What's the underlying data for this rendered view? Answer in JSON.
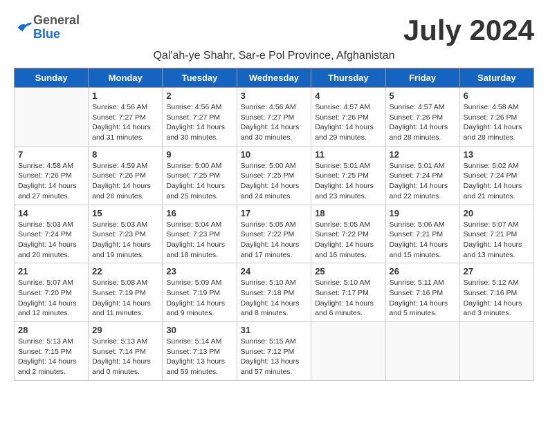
{
  "header": {
    "logo_general": "General",
    "logo_blue": "Blue",
    "month_year": "July 2024",
    "location": "Qal'ah-ye Shahr, Sar-e Pol Province, Afghanistan"
  },
  "days_of_week": [
    "Sunday",
    "Monday",
    "Tuesday",
    "Wednesday",
    "Thursday",
    "Friday",
    "Saturday"
  ],
  "weeks": [
    [
      {
        "day": "",
        "detail": ""
      },
      {
        "day": "1",
        "detail": "Sunrise: 4:56 AM\nSunset: 7:27 PM\nDaylight: 14 hours\nand 31 minutes."
      },
      {
        "day": "2",
        "detail": "Sunrise: 4:56 AM\nSunset: 7:27 PM\nDaylight: 14 hours\nand 30 minutes."
      },
      {
        "day": "3",
        "detail": "Sunrise: 4:56 AM\nSunset: 7:27 PM\nDaylight: 14 hours\nand 30 minutes."
      },
      {
        "day": "4",
        "detail": "Sunrise: 4:57 AM\nSunset: 7:26 PM\nDaylight: 14 hours\nand 29 minutes."
      },
      {
        "day": "5",
        "detail": "Sunrise: 4:57 AM\nSunset: 7:26 PM\nDaylight: 14 hours\nand 28 minutes."
      },
      {
        "day": "6",
        "detail": "Sunrise: 4:58 AM\nSunset: 7:26 PM\nDaylight: 14 hours\nand 28 minutes."
      }
    ],
    [
      {
        "day": "7",
        "detail": "Sunrise: 4:58 AM\nSunset: 7:26 PM\nDaylight: 14 hours\nand 27 minutes."
      },
      {
        "day": "8",
        "detail": "Sunrise: 4:59 AM\nSunset: 7:26 PM\nDaylight: 14 hours\nand 26 minutes."
      },
      {
        "day": "9",
        "detail": "Sunrise: 5:00 AM\nSunset: 7:25 PM\nDaylight: 14 hours\nand 25 minutes."
      },
      {
        "day": "10",
        "detail": "Sunrise: 5:00 AM\nSunset: 7:25 PM\nDaylight: 14 hours\nand 24 minutes."
      },
      {
        "day": "11",
        "detail": "Sunrise: 5:01 AM\nSunset: 7:25 PM\nDaylight: 14 hours\nand 23 minutes."
      },
      {
        "day": "12",
        "detail": "Sunrise: 5:01 AM\nSunset: 7:24 PM\nDaylight: 14 hours\nand 22 minutes."
      },
      {
        "day": "13",
        "detail": "Sunrise: 5:02 AM\nSunset: 7:24 PM\nDaylight: 14 hours\nand 21 minutes."
      }
    ],
    [
      {
        "day": "14",
        "detail": "Sunrise: 5:03 AM\nSunset: 7:24 PM\nDaylight: 14 hours\nand 20 minutes."
      },
      {
        "day": "15",
        "detail": "Sunrise: 5:03 AM\nSunset: 7:23 PM\nDaylight: 14 hours\nand 19 minutes."
      },
      {
        "day": "16",
        "detail": "Sunrise: 5:04 AM\nSunset: 7:23 PM\nDaylight: 14 hours\nand 18 minutes."
      },
      {
        "day": "17",
        "detail": "Sunrise: 5:05 AM\nSunset: 7:22 PM\nDaylight: 14 hours\nand 17 minutes."
      },
      {
        "day": "18",
        "detail": "Sunrise: 5:05 AM\nSunset: 7:22 PM\nDaylight: 14 hours\nand 16 minutes."
      },
      {
        "day": "19",
        "detail": "Sunrise: 5:06 AM\nSunset: 7:21 PM\nDaylight: 14 hours\nand 15 minutes."
      },
      {
        "day": "20",
        "detail": "Sunrise: 5:07 AM\nSunset: 7:21 PM\nDaylight: 14 hours\nand 13 minutes."
      }
    ],
    [
      {
        "day": "21",
        "detail": "Sunrise: 5:07 AM\nSunset: 7:20 PM\nDaylight: 14 hours\nand 12 minutes."
      },
      {
        "day": "22",
        "detail": "Sunrise: 5:08 AM\nSunset: 7:19 PM\nDaylight: 14 hours\nand 11 minutes."
      },
      {
        "day": "23",
        "detail": "Sunrise: 5:09 AM\nSunset: 7:19 PM\nDaylight: 14 hours\nand 9 minutes."
      },
      {
        "day": "24",
        "detail": "Sunrise: 5:10 AM\nSunset: 7:18 PM\nDaylight: 14 hours\nand 8 minutes."
      },
      {
        "day": "25",
        "detail": "Sunrise: 5:10 AM\nSunset: 7:17 PM\nDaylight: 14 hours\nand 6 minutes."
      },
      {
        "day": "26",
        "detail": "Sunrise: 5:11 AM\nSunset: 7:16 PM\nDaylight: 14 hours\nand 5 minutes."
      },
      {
        "day": "27",
        "detail": "Sunrise: 5:12 AM\nSunset: 7:16 PM\nDaylight: 14 hours\nand 3 minutes."
      }
    ],
    [
      {
        "day": "28",
        "detail": "Sunrise: 5:13 AM\nSunset: 7:15 PM\nDaylight: 14 hours\nand 2 minutes."
      },
      {
        "day": "29",
        "detail": "Sunrise: 5:13 AM\nSunset: 7:14 PM\nDaylight: 14 hours\nand 0 minutes."
      },
      {
        "day": "30",
        "detail": "Sunrise: 5:14 AM\nSunset: 7:13 PM\nDaylight: 13 hours\nand 59 minutes."
      },
      {
        "day": "31",
        "detail": "Sunrise: 5:15 AM\nSunset: 7:12 PM\nDaylight: 13 hours\nand 57 minutes."
      },
      {
        "day": "",
        "detail": ""
      },
      {
        "day": "",
        "detail": ""
      },
      {
        "day": "",
        "detail": ""
      }
    ]
  ]
}
